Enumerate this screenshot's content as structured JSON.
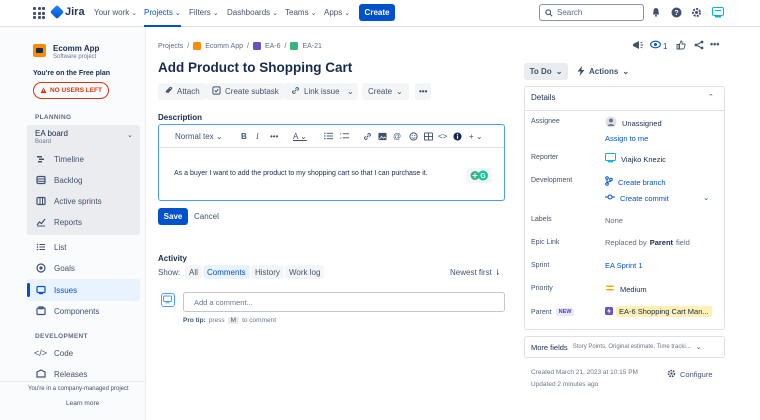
{
  "topnav": {
    "brand": "Jira",
    "items": [
      {
        "label": "Your work",
        "active": false
      },
      {
        "label": "Projects",
        "active": true
      },
      {
        "label": "Filters",
        "active": false
      },
      {
        "label": "Dashboards",
        "active": false
      },
      {
        "label": "Teams",
        "active": false
      },
      {
        "label": "Apps",
        "active": false
      }
    ],
    "create_label": "Create",
    "search_placeholder": "Search"
  },
  "sidebar": {
    "project_name": "Ecomm App",
    "project_type": "Software project",
    "plan_text": "You're on the Free plan",
    "no_users_label": "NO USERS LEFT",
    "planning_header": "PLANNING",
    "board_title": "EA board",
    "board_sub": "Board",
    "board_items": [
      "Timeline",
      "Backlog",
      "Active sprints",
      "Reports"
    ],
    "items": [
      "List",
      "Goals",
      "Issues",
      "Components"
    ],
    "development_header": "DEVELOPMENT",
    "dev_items": [
      "Code",
      "Releases"
    ],
    "company_text": "You're in a company-managed project",
    "learn_more": "Learn more"
  },
  "breadcrumb": [
    "Projects",
    "Ecomm App",
    "EA-6",
    "EA-21"
  ],
  "issue": {
    "title": "Add Product to Shopping Cart",
    "toolbar": {
      "attach": "Attach",
      "create_subtask": "Create subtask",
      "link_issue": "Link issue",
      "create": "Create"
    },
    "description_header": "Description",
    "editor_style": "Normal tex",
    "description_text": "As a buyer I want to add the product to my shopping cart so that I can purchase it.",
    "save": "Save",
    "cancel": "Cancel"
  },
  "activity": {
    "header": "Activity",
    "show_label": "Show:",
    "filters": [
      {
        "label": "All",
        "active": false
      },
      {
        "label": "Comments",
        "active": true
      },
      {
        "label": "History",
        "active": false
      },
      {
        "label": "Work log",
        "active": false
      }
    ],
    "sort": "Newest first",
    "comment_placeholder": "Add a comment...",
    "protip_label": "Pro tip:",
    "protip_press": "press",
    "protip_key": "M",
    "protip_suffix": "to comment"
  },
  "panel": {
    "watch_count": "1",
    "status": "To Do",
    "actions": "Actions",
    "details_header": "Details",
    "fields": {
      "assignee_label": "Assignee",
      "assignee_value": "Unassigned",
      "assign_to_me": "Assign to me",
      "reporter_label": "Reporter",
      "reporter_value": "Viajko Knezic",
      "development_label": "Development",
      "create_branch": "Create branch",
      "create_commit": "Create commit",
      "labels_label": "Labels",
      "labels_value": "None",
      "epic_label": "Epic Link",
      "epic_prefix": "Replaced by",
      "epic_bold": "Parent",
      "epic_suffix": "field",
      "sprint_label": "Sprint",
      "sprint_value": "EA Sprint 1",
      "priority_label": "Priority",
      "priority_value": "Medium",
      "parent_label": "Parent",
      "parent_badge": "NEW",
      "parent_value": "EA-6 Shopping Cart Man..."
    },
    "more_fields_label": "More fields",
    "more_fields_sub": "Story Points, Original estimate, Time tracki...",
    "created": "Created March 21, 2023 at 10:15 PM",
    "updated": "Updated 2 minutes ago",
    "configure": "Configure"
  }
}
